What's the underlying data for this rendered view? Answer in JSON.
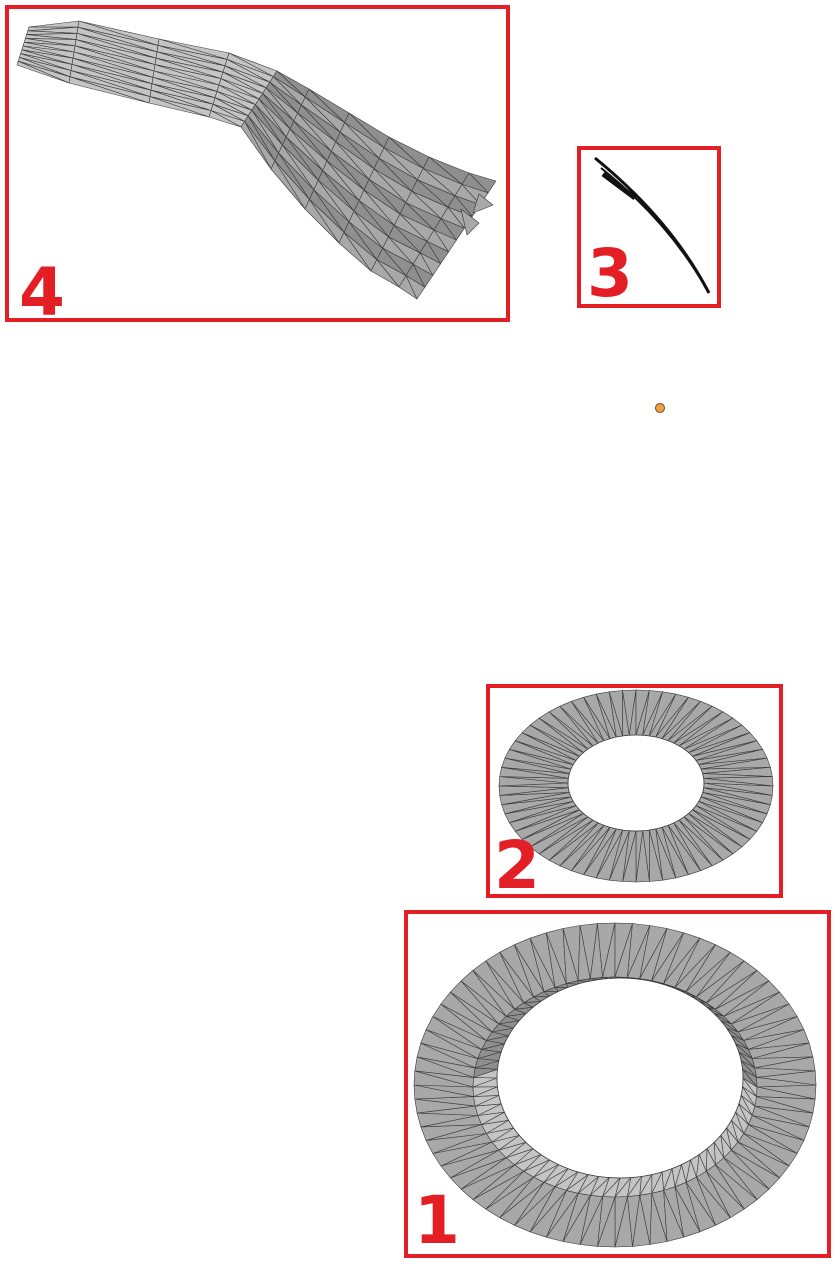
{
  "panels": [
    {
      "id": "panel-4",
      "label": "4",
      "content": "swept-mesh-surface"
    },
    {
      "id": "panel-3",
      "label": "3",
      "content": "curved-strip-edge-view"
    },
    {
      "id": "panel-2",
      "label": "2",
      "content": "flat-annulus-mesh"
    },
    {
      "id": "panel-1",
      "label": "1",
      "content": "raised-annulus-mesh"
    }
  ],
  "colors": {
    "frame": "#e31e24",
    "mesh_fill": "#a8a8a8",
    "mesh_fill_dark": "#8f8f8f",
    "mesh_fill_light": "#c4c4c4",
    "mesh_edge": "#3a3a3a",
    "marker_fill": "#f5a142",
    "marker_stroke": "#6b4a20"
  }
}
